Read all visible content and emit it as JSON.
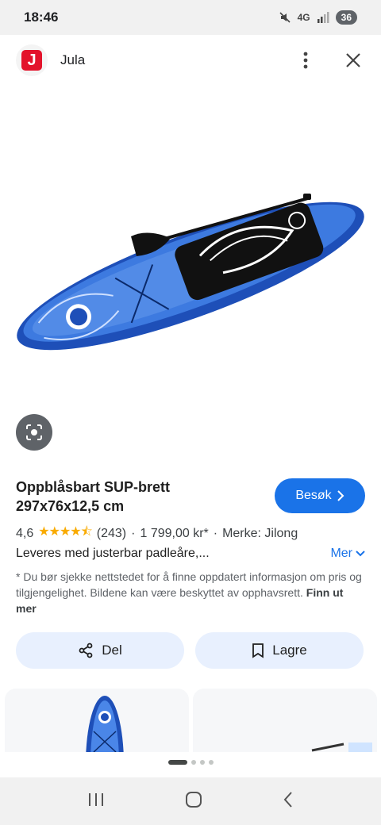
{
  "status": {
    "time": "18:46",
    "network": "4G",
    "battery": "36"
  },
  "header": {
    "logo_letter": "J",
    "site_name": "Jula"
  },
  "product": {
    "title_line1": "Oppblåsbart SUP-brett",
    "title_line2": "297x76x12,5 cm",
    "visit_label": "Besøk",
    "rating": "4,6",
    "rating_value": 4.6,
    "reviews": "(243)",
    "price": "1 799,00 kr*",
    "brand": "Merke: Jilong",
    "description": "Leveres med justerbar padleåre,...",
    "more_label": "Mer",
    "disclaimer": "* Du bør sjekke nettstedet for å finne oppdatert informasjon om pris og tilgjengelighet. Bildene kan være beskyttet av opphavsrett.",
    "disclaimer_link": "Finn ut mer"
  },
  "actions": {
    "share_label": "Del",
    "save_label": "Lagre"
  },
  "colors": {
    "accent": "#1a73e8",
    "brand_red": "#e3132b",
    "button_bg": "#e8f0fe"
  }
}
